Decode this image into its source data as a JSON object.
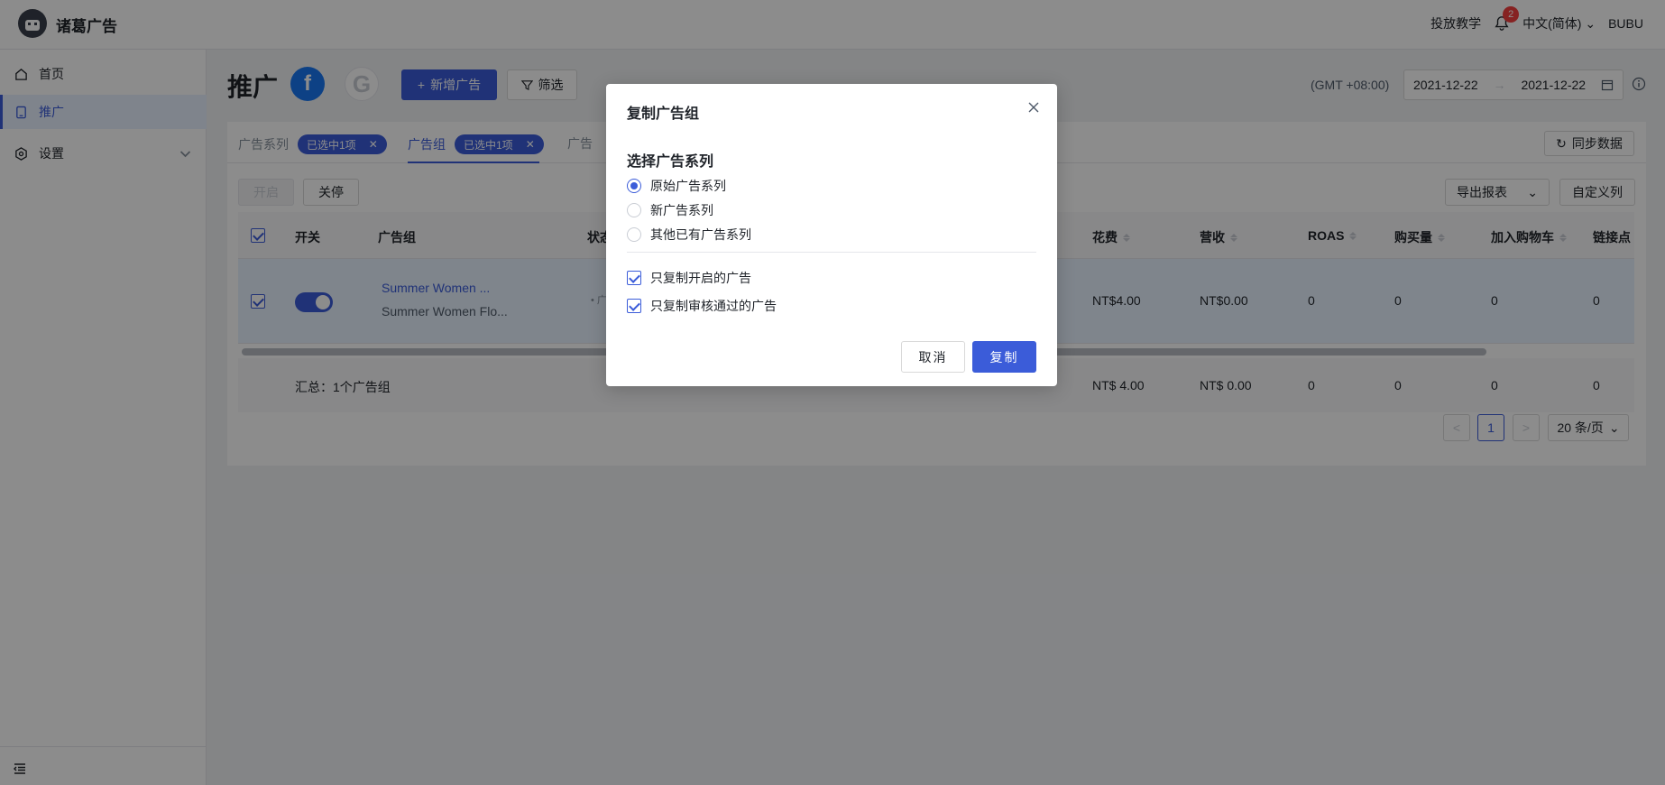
{
  "header": {
    "brand": "诸葛广告",
    "tutorial": "投放教学",
    "notification_count": "2",
    "language": "中文(简体)",
    "user": "BUBU"
  },
  "sidebar": {
    "items": [
      {
        "label": "首页",
        "icon": "home-icon"
      },
      {
        "label": "推广",
        "icon": "tablet-icon",
        "active": true
      },
      {
        "label": "设置",
        "icon": "settings-icon"
      }
    ]
  },
  "page": {
    "title": "推广",
    "facebook_glyph": "f",
    "google_glyph": "G",
    "add_ad": "新增广告",
    "filter": "筛选",
    "timezone": "(GMT +08:00)",
    "date_start": "2021-12-22",
    "date_arrow": "→",
    "date_end": "2021-12-22"
  },
  "tabs": [
    {
      "label": "广告系列",
      "chip": "已选中1项"
    },
    {
      "label": "广告组",
      "chip": "已选中1项",
      "active": true
    },
    {
      "label": "广告"
    }
  ],
  "toolbar": {
    "enable": "开启",
    "disable": "关停",
    "sync": "同步数据",
    "export": "导出报表",
    "custom_columns": "自定义列"
  },
  "table": {
    "headers": {
      "switch": "开关",
      "adgroup": "广告组",
      "status": "状态",
      "spend": "花费",
      "revenue": "营收",
      "roas": "ROAS",
      "purchases": "购买量",
      "add_to_cart": "加入购物车",
      "link_clicks": "链接点"
    },
    "row": {
      "name": "Summer Women ...",
      "sub": "Summer Women Flo...",
      "status_partial": "• 广",
      "spend": "NT$4.00",
      "revenue": "NT$0.00",
      "roas": "0",
      "purchases": "0",
      "add_to_cart": "0",
      "link_clicks": "0"
    },
    "footer": {
      "summary": "汇总：1个广告组",
      "spend": "NT$ 4.00",
      "revenue": "NT$ 0.00",
      "roas": "0",
      "purchases": "0",
      "add_to_cart": "0",
      "link_clicks": "0"
    }
  },
  "pagination": {
    "prev": "<",
    "current": "1",
    "next": ">",
    "page_size": "20 条/页"
  },
  "modal": {
    "title": "复制广告组",
    "section": "选择广告系列",
    "radios": [
      "原始广告系列",
      "新广告系列",
      "其他已有广告系列"
    ],
    "checkboxes": [
      "只复制开启的广告",
      "只复制审核通过的广告"
    ],
    "cancel": "取消",
    "confirm": "复制"
  },
  "colors": {
    "primary": "#3b5cd9",
    "facebook": "#1877f2",
    "badge": "#f53f3f"
  }
}
